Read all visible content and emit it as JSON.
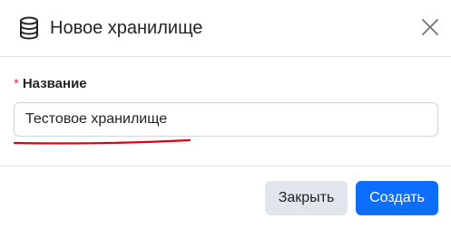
{
  "modal": {
    "title": "Новое хранилище",
    "icon": "database-icon",
    "close_icon": "close-icon"
  },
  "form": {
    "name_field": {
      "required_mark": "*",
      "label": "Название",
      "value": "Тестовое хранилище"
    }
  },
  "footer": {
    "close_label": "Закрыть",
    "create_label": "Создать"
  },
  "colors": {
    "primary": "#0d6efd",
    "secondary": "#e2e6ec",
    "required": "#dc3545",
    "annotation_underline": "#e0000f"
  }
}
